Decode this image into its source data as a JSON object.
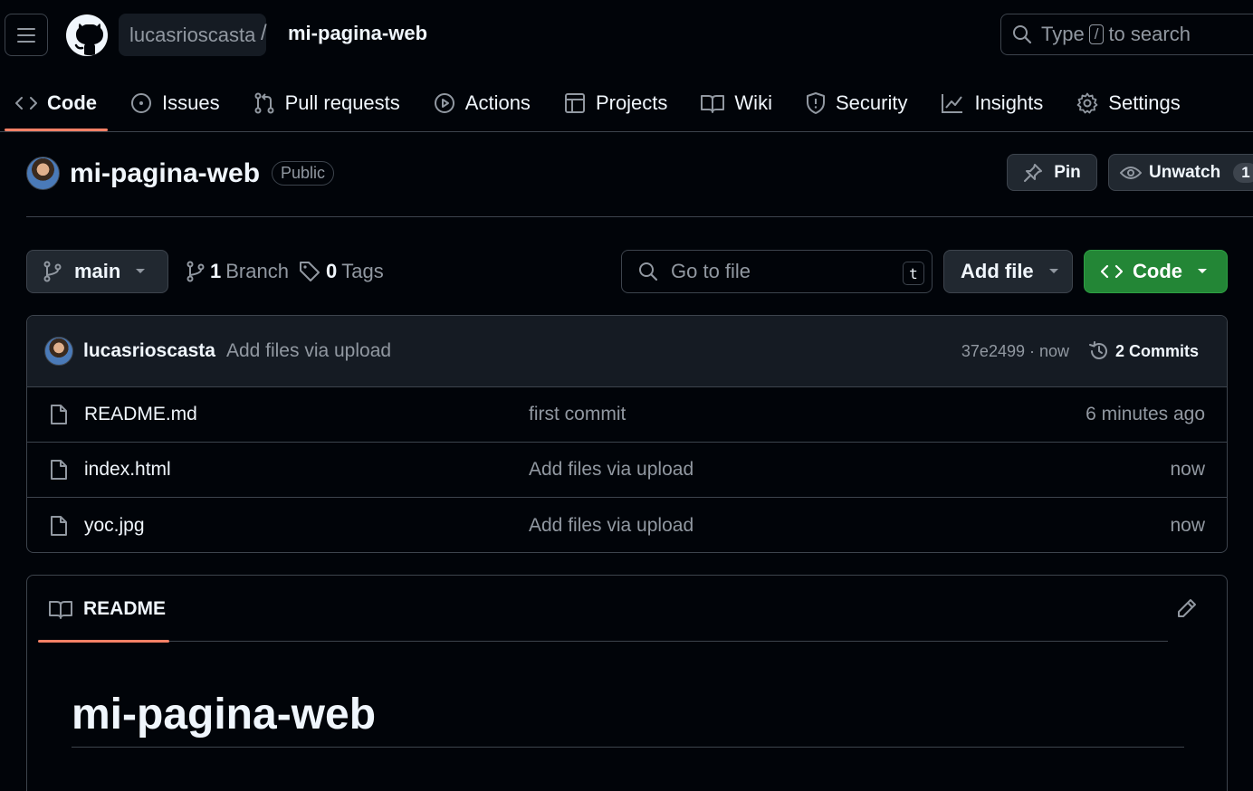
{
  "header": {
    "owner": "lucasrioscasta",
    "separator": "/",
    "repo": "mi-pagina-web",
    "search": {
      "prefix": "Type",
      "key": "/",
      "suffix": "to search"
    }
  },
  "tabs": [
    {
      "label": "Code",
      "icon": "code-icon",
      "selected": true
    },
    {
      "label": "Issues",
      "icon": "issue-icon"
    },
    {
      "label": "Pull requests",
      "icon": "git-pull-request-icon"
    },
    {
      "label": "Actions",
      "icon": "play-icon"
    },
    {
      "label": "Projects",
      "icon": "table-icon"
    },
    {
      "label": "Wiki",
      "icon": "book-icon"
    },
    {
      "label": "Security",
      "icon": "shield-icon"
    },
    {
      "label": "Insights",
      "icon": "graph-icon"
    },
    {
      "label": "Settings",
      "icon": "gear-icon"
    }
  ],
  "repo": {
    "name": "mi-pagina-web",
    "visibility": "Public",
    "pin_label": "Pin",
    "watch_label": "Unwatch",
    "watch_count": "1"
  },
  "branch_bar": {
    "branch": "main",
    "branches_count": "1",
    "branches_label": "Branch",
    "tags_count": "0",
    "tags_label": "Tags",
    "goto_placeholder": "Go to file",
    "goto_key": "t",
    "add_file_label": "Add file",
    "code_label": "Code"
  },
  "latest_commit": {
    "author": "lucasrioscasta",
    "message": "Add files via upload",
    "hash_time": "37e2499 · now",
    "commits_label": "2 Commits"
  },
  "files": [
    {
      "name": "README.md",
      "commit": "first commit",
      "time": "6 minutes ago"
    },
    {
      "name": "index.html",
      "commit": "Add files via upload",
      "time": "now"
    },
    {
      "name": "yoc.jpg",
      "commit": "Add files via upload",
      "time": "now"
    }
  ],
  "readme": {
    "tab_label": "README",
    "heading": "mi-pagina-web"
  },
  "colors": {
    "background": "#010409",
    "accent_underline": "#f78166",
    "code_button": "#238636"
  }
}
